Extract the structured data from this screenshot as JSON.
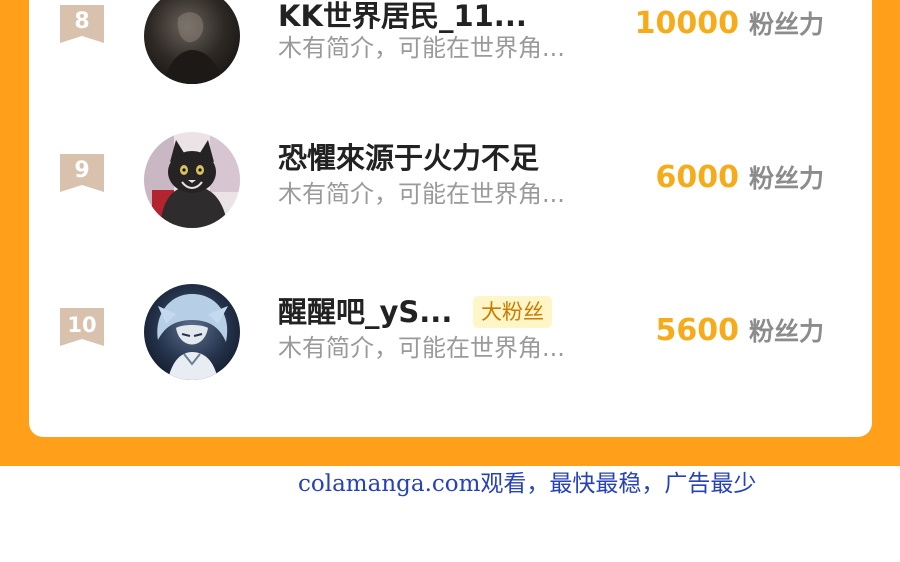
{
  "leaderboard": {
    "entries": [
      {
        "rank": "8",
        "name": "KK世界居民_11...",
        "description": "木有简介，可能在世界角...",
        "score": "10000",
        "score_unit": "粉丝力"
      },
      {
        "rank": "9",
        "name": "恐懼來源于火力不足",
        "description": "木有简介，可能在世界角...",
        "score": "6000",
        "score_unit": "粉丝力"
      },
      {
        "rank": "10",
        "name": "醒醒吧_yS...",
        "badge": "大粉丝",
        "description": "木有简介，可能在世界角...",
        "score": "5600",
        "score_unit": "粉丝力"
      }
    ]
  },
  "watermark": "colamanga.com观看，最快最稳，广告最少",
  "colors": {
    "page_background": "#ff9f1a",
    "rank_badge": "#d8c2ad",
    "score": "#f6ac1a",
    "fan_badge_background": "#fff6c7",
    "watermark": "#2742b8"
  }
}
